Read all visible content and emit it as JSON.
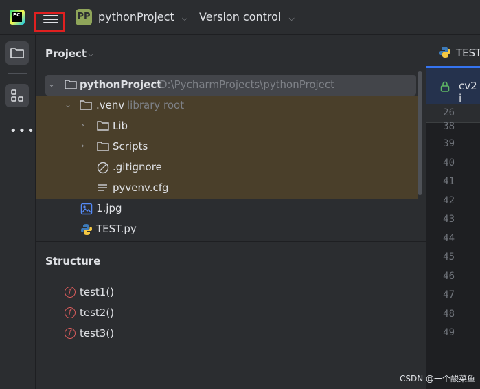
{
  "titlebar": {
    "logo_text": "PC",
    "project_avatar": "PP",
    "project_name": "pythonProject",
    "vcs_label": "Version control",
    "chevron": "⌵"
  },
  "project_panel": {
    "title": "Project",
    "tree": {
      "root_name": "pythonProject",
      "root_path": "D:\\PycharmProjects\\pythonProject",
      "venv_name": ".venv",
      "venv_hint": "library root",
      "lib": "Lib",
      "scripts": "Scripts",
      "gitignore": ".gitignore",
      "pyvenv": "pyvenv.cfg",
      "jpg": "1.jpg",
      "testpy": "TEST.py"
    }
  },
  "structure_panel": {
    "title": "Structure",
    "functions": [
      "test1()",
      "test2()",
      "test3()"
    ],
    "fn_badge": "f"
  },
  "editor": {
    "tab_label": "TEST",
    "notification": "cv2 i",
    "sticky_line": "26",
    "line_numbers": [
      "38",
      "39",
      "40",
      "41",
      "42",
      "43",
      "44",
      "45",
      "46",
      "47",
      "48",
      "49"
    ]
  },
  "watermark": "CSDN @一个酸菜鱼",
  "icons": {
    "hamburger": "hamburger-menu-icon",
    "folder": "folder-icon",
    "structure": "structure-icon",
    "more": "more-icon",
    "python": "python-file-icon",
    "image": "image-file-icon",
    "ignore": "gitignore-icon",
    "text": "text-file-icon",
    "lock": "lock-icon"
  },
  "colors": {
    "highlight_box": "#e02020",
    "library_root_bg": "#4a3f2a",
    "accent": "#3574f0"
  }
}
